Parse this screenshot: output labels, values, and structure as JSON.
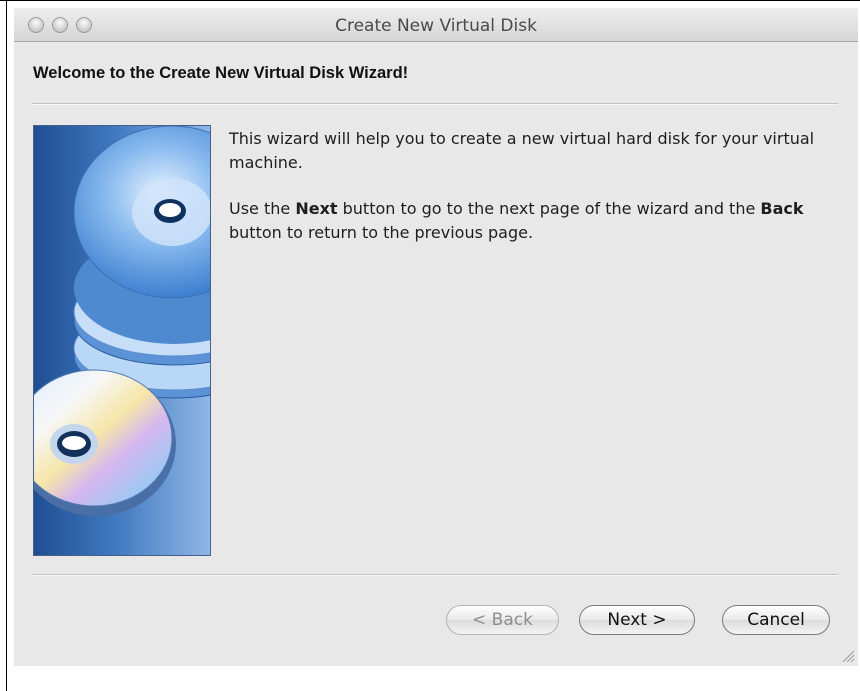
{
  "window": {
    "title": "Create New Virtual Disk"
  },
  "wizard": {
    "heading": "Welcome to the Create New Virtual Disk Wizard!",
    "paragraph1": "This wizard will help you to create a new virtual hard disk for your virtual machine.",
    "p2_part1": "Use the ",
    "p2_bold1": "Next",
    "p2_part2": " button to go to the next page of the wizard and the ",
    "p2_bold2": "Back",
    "p2_part3": " button to return to the previous page."
  },
  "buttons": {
    "back": "< Back",
    "next": "Next >",
    "cancel": "Cancel"
  },
  "button_state": {
    "back_enabled": false
  },
  "colors": {
    "panel_bg": "#e8e8e8",
    "art_dark": "#1f4e92",
    "art_light": "#8fb7e6"
  },
  "icons": [
    "close-traffic-icon",
    "minimize-traffic-icon",
    "zoom-traffic-icon",
    "disk-stack-graphic",
    "resize-grip-icon"
  ]
}
